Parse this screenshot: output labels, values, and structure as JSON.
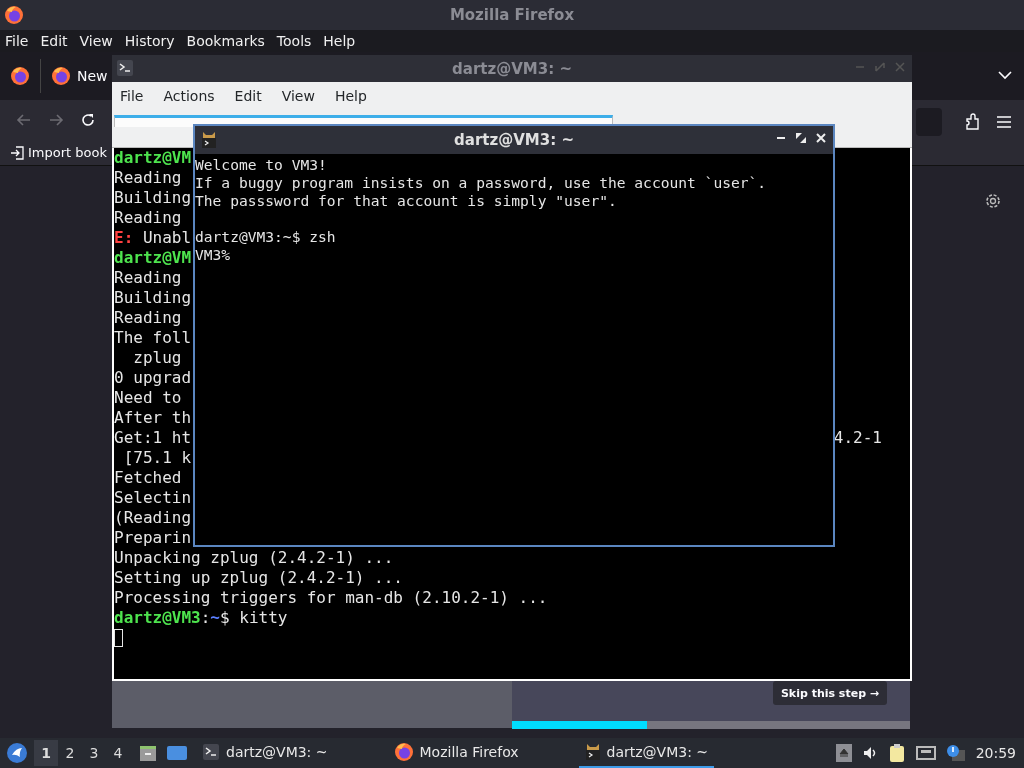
{
  "firefox": {
    "title": "Mozilla Firefox",
    "menu": [
      {
        "label": "File"
      },
      {
        "label": "Edit"
      },
      {
        "label": "View"
      },
      {
        "label": "History"
      },
      {
        "label": "Bookmarks"
      },
      {
        "label": "Tools"
      },
      {
        "label": "Help"
      }
    ],
    "tab_label": "New",
    "bookmark": "Import book",
    "skip_button": "Skip this step →",
    "progress": {
      "level": 0.34
    }
  },
  "terminal": {
    "title": "dartz@VM3: ~",
    "menu": [
      {
        "label": "File"
      },
      {
        "label": "Actions"
      },
      {
        "label": "Edit"
      },
      {
        "label": "View"
      },
      {
        "label": "Help"
      }
    ],
    "lines": [
      {
        "segments": [
          {
            "kind": "user",
            "text": "dartz@VM"
          }
        ]
      },
      {
        "segments": [
          {
            "kind": "plain",
            "text": "Reading"
          }
        ]
      },
      {
        "segments": [
          {
            "kind": "plain",
            "text": "Building"
          }
        ]
      },
      {
        "segments": [
          {
            "kind": "plain",
            "text": "Reading"
          }
        ]
      },
      {
        "segments": [
          {
            "kind": "error",
            "text": "E:"
          },
          {
            "kind": "plain",
            "text": " Unabl"
          }
        ]
      },
      {
        "segments": [
          {
            "kind": "user",
            "text": "dartz@VM"
          }
        ]
      },
      {
        "segments": [
          {
            "kind": "plain",
            "text": "Reading"
          }
        ]
      },
      {
        "segments": [
          {
            "kind": "plain",
            "text": "Building"
          }
        ]
      },
      {
        "segments": [
          {
            "kind": "plain",
            "text": "Reading"
          }
        ]
      },
      {
        "segments": [
          {
            "kind": "plain",
            "text": "The foll"
          }
        ]
      },
      {
        "segments": [
          {
            "kind": "plain",
            "text": "  zplug"
          }
        ]
      },
      {
        "segments": [
          {
            "kind": "plain",
            "text": "0 upgrad"
          }
        ]
      },
      {
        "segments": [
          {
            "kind": "plain",
            "text": "Need to"
          }
        ]
      },
      {
        "segments": [
          {
            "kind": "plain",
            "text": "After th"
          }
        ]
      },
      {
        "segments": [
          {
            "kind": "plain",
            "text": "Get:1 ht"
          }
        ],
        "right": "4.2-1"
      },
      {
        "segments": [
          {
            "kind": "plain",
            "text": " [75.1 k"
          }
        ]
      },
      {
        "segments": [
          {
            "kind": "plain",
            "text": "Fetched"
          }
        ]
      },
      {
        "segments": [
          {
            "kind": "plain",
            "text": "Selectin"
          }
        ]
      },
      {
        "segments": [
          {
            "kind": "plain",
            "text": "(Reading"
          }
        ]
      },
      {
        "segments": [
          {
            "kind": "plain",
            "text": "Preparin"
          }
        ]
      },
      {
        "segments": [
          {
            "kind": "plain",
            "text": "Unpacking zplug (2.4.2-1) ..."
          }
        ]
      },
      {
        "segments": [
          {
            "kind": "plain",
            "text": "Setting up zplug (2.4.2-1) ..."
          }
        ]
      },
      {
        "segments": [
          {
            "kind": "plain",
            "text": "Processing triggers for man-db (2.10.2-1) ..."
          }
        ]
      },
      {
        "segments": [
          {
            "kind": "user",
            "text": "dartz@VM3"
          },
          {
            "kind": "plain",
            "text": ":"
          },
          {
            "kind": "path",
            "text": "~"
          },
          {
            "kind": "plain",
            "text": "$ kitty"
          }
        ]
      }
    ],
    "cursor": true
  },
  "kitty": {
    "title": "dartz@VM3: ~",
    "blocks": [
      [
        "Welcome to VM3!",
        "If a buggy program insists on a password, use the account `user`.",
        "The passsword for that account is simply \"user\"."
      ],
      [
        "dartz@VM3:~$ zsh",
        "VM3%"
      ]
    ]
  },
  "taskbar": {
    "workspaces": [
      {
        "label": "1",
        "selected": true
      },
      {
        "label": "2",
        "selected": false
      },
      {
        "label": "3",
        "selected": false
      },
      {
        "label": "4",
        "selected": false
      }
    ],
    "tasks": [
      {
        "kind": "terminal",
        "label": "dartz@VM3: ~",
        "selected": false
      },
      {
        "kind": "firefox",
        "label": "Mozilla Firefox",
        "selected": false
      },
      {
        "kind": "kitty",
        "label": "dartz@VM3: ~",
        "selected": true
      }
    ],
    "clock": "20:59"
  }
}
